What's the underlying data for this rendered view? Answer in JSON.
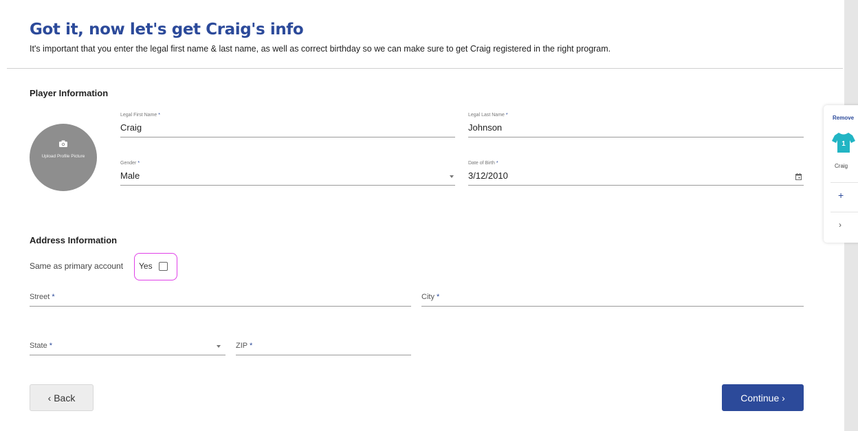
{
  "header": {
    "title": "Got it, now let's get Craig's info",
    "subtitle": "It's important that you enter the legal first name & last name, as well as correct birthday so we can make sure to get Craig registered in the right program."
  },
  "player_section": {
    "title": "Player Information",
    "avatar_label": "Upload Profile Picture",
    "first_name": {
      "label": "Legal First Name",
      "value": "Craig"
    },
    "last_name": {
      "label": "Legal Last Name",
      "value": "Johnson"
    },
    "gender": {
      "label": "Gender",
      "value": "Male"
    },
    "dob": {
      "label": "Date of Birth",
      "value": "3/12/2010"
    },
    "required_mark": "*"
  },
  "address_section": {
    "title": "Address Information",
    "same_as_label": "Same as primary account",
    "yes_label": "Yes",
    "street_label": "Street",
    "city_label": "City",
    "state_label": "State",
    "zip_label": "ZIP"
  },
  "buttons": {
    "back": "‹ Back",
    "continue": "Continue ›"
  },
  "side_panel": {
    "remove": "Remove",
    "player_number": "1",
    "player_name": "Craig",
    "add": "+",
    "next": "›"
  },
  "colors": {
    "brand": "#2c4a9a",
    "highlight": "#e040e8",
    "shirt": "#22b5c4"
  }
}
